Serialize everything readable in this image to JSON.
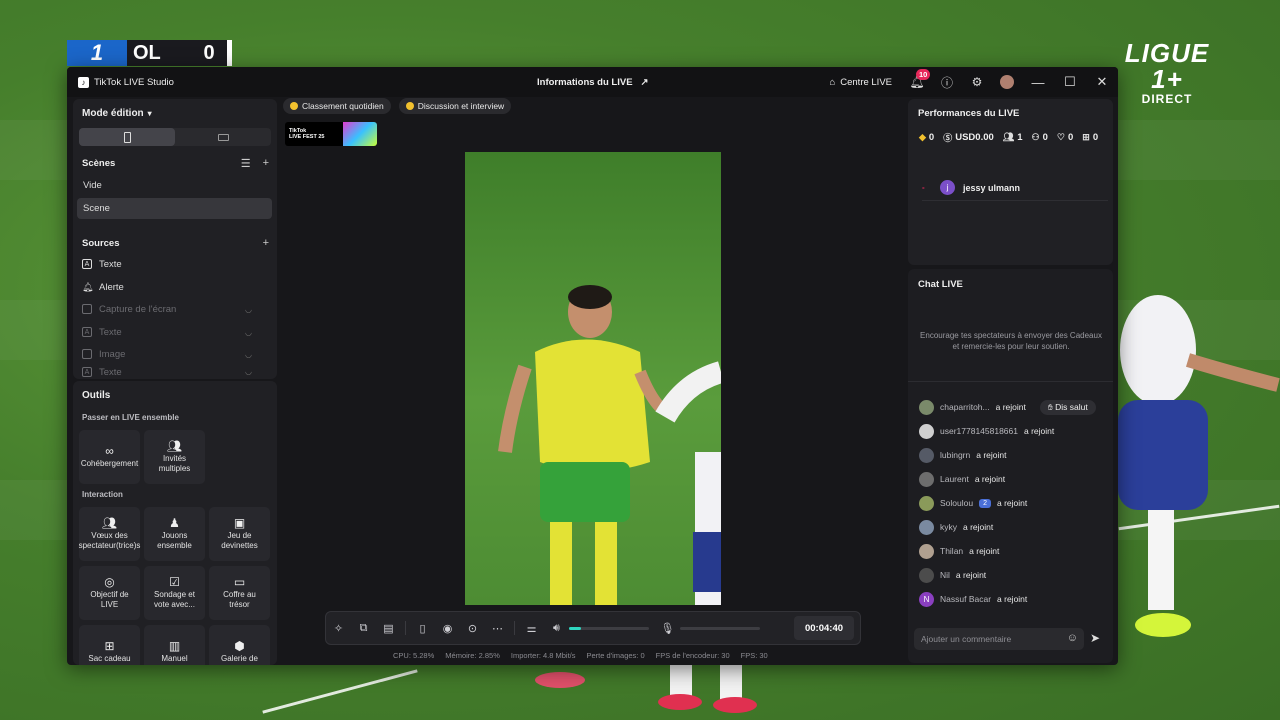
{
  "broadcast": {
    "team": "OL",
    "score": "0",
    "league_logo_line1": "LIGUE 1+",
    "league_logo_line2": "DIRECT"
  },
  "titlebar": {
    "app_name": "TikTok LIVE Studio",
    "live_info": "Informations du LIVE",
    "centre_live": "Centre LIVE",
    "notifications_count": "10"
  },
  "left": {
    "mode_title": "Mode édition",
    "scenes_title": "Scènes",
    "scenes": [
      "Vide",
      "Scene"
    ],
    "sources_title": "Sources",
    "sources": [
      {
        "label": "Texte",
        "icon": "text-icon",
        "enabled": true
      },
      {
        "label": "Alerte",
        "icon": "bell-icon",
        "enabled": true
      },
      {
        "label": "Capture de l'écran",
        "icon": "monitor-icon",
        "enabled": false
      },
      {
        "label": "Texte",
        "icon": "text-icon",
        "enabled": false
      },
      {
        "label": "Image",
        "icon": "image-icon",
        "enabled": false
      },
      {
        "label": "Texte",
        "icon": "text-icon",
        "enabled": false
      }
    ],
    "tools_title": "Outils",
    "live_together_title": "Passer en LIVE ensemble",
    "live_together": [
      "Cohébergement",
      "Invités multiples"
    ],
    "interaction_title": "Interaction",
    "interaction": [
      "Vœux des spectateur(trice)s",
      "Jouons ensemble",
      "Jeu de devinettes",
      "Objectif de LIVE",
      "Sondage et vote avec...",
      "Coffre au trésor",
      "Sac cadeau",
      "Manuel",
      "Galerie de"
    ]
  },
  "center": {
    "chips": [
      "Classement quotidien",
      "Discussion et interview"
    ],
    "fest_label_line1": "TikTok",
    "fest_label_line2": "LIVE FEST 25",
    "timer": "00:04:40",
    "volume_level": 0.15,
    "mic_level": 0.0,
    "stats": [
      "CPU: 5.28%",
      "Mémoire: 2.85%",
      "Importer: 4.8 Mbit/s",
      "Perte d'images: 0",
      "FPS de l'encodeur: 30",
      "FPS: 30"
    ]
  },
  "performance": {
    "title": "Performances du LIVE",
    "metrics": [
      {
        "icon": "diamond-icon",
        "value": "0"
      },
      {
        "icon": "dollar-icon",
        "value": "USD0.00"
      },
      {
        "icon": "viewers-icon",
        "value": "1"
      },
      {
        "icon": "new-followers-icon",
        "value": "0"
      },
      {
        "icon": "heart-icon",
        "value": "0"
      },
      {
        "icon": "gift-icon",
        "value": "0"
      }
    ],
    "rank_marker": "-",
    "top_viewer": {
      "initial": "j",
      "name": "jessy ulmann",
      "color": "#7b4fc9"
    }
  },
  "chat": {
    "title": "Chat LIVE",
    "encourage": "Encourage tes spectateurs à envoyer des Cadeaux et remercie-les pour leur soutien.",
    "joined_text": "a rejoint",
    "say_hi": "Dis salut",
    "messages": [
      {
        "name": "chaparritoh...",
        "avatar_color": "#7a8a6a",
        "initial": "",
        "level": "",
        "hi": true
      },
      {
        "name": "user1778145818661",
        "avatar_color": "#cfcfcf",
        "initial": "",
        "level": "",
        "hi": false
      },
      {
        "name": "lubingrn",
        "avatar_color": "#555a66",
        "initial": "",
        "level": "",
        "hi": false
      },
      {
        "name": "Laurent",
        "avatar_color": "#6d6d6d",
        "initial": "",
        "level": "",
        "hi": false
      },
      {
        "name": "Soloulou",
        "avatar_color": "#8a9a5a",
        "initial": "",
        "level": "2",
        "hi": false
      },
      {
        "name": "kyky",
        "avatar_color": "#7a8aa0",
        "initial": "",
        "level": "",
        "hi": false
      },
      {
        "name": "Thilan",
        "avatar_color": "#b0a090",
        "initial": "",
        "level": "",
        "hi": false
      },
      {
        "name": "Nil",
        "avatar_color": "#4c4c4c",
        "initial": "",
        "level": "",
        "hi": false
      },
      {
        "name": "Nassuf Bacar",
        "avatar_color": "#8a3fc0",
        "initial": "N",
        "level": "",
        "hi": false
      }
    ],
    "comment_placeholder": "Ajouter un commentaire"
  },
  "colors": {
    "accent": "#2fd6c0",
    "badge": "#e6285a",
    "window_bg": "#17171a",
    "panel_bg": "#202024"
  }
}
